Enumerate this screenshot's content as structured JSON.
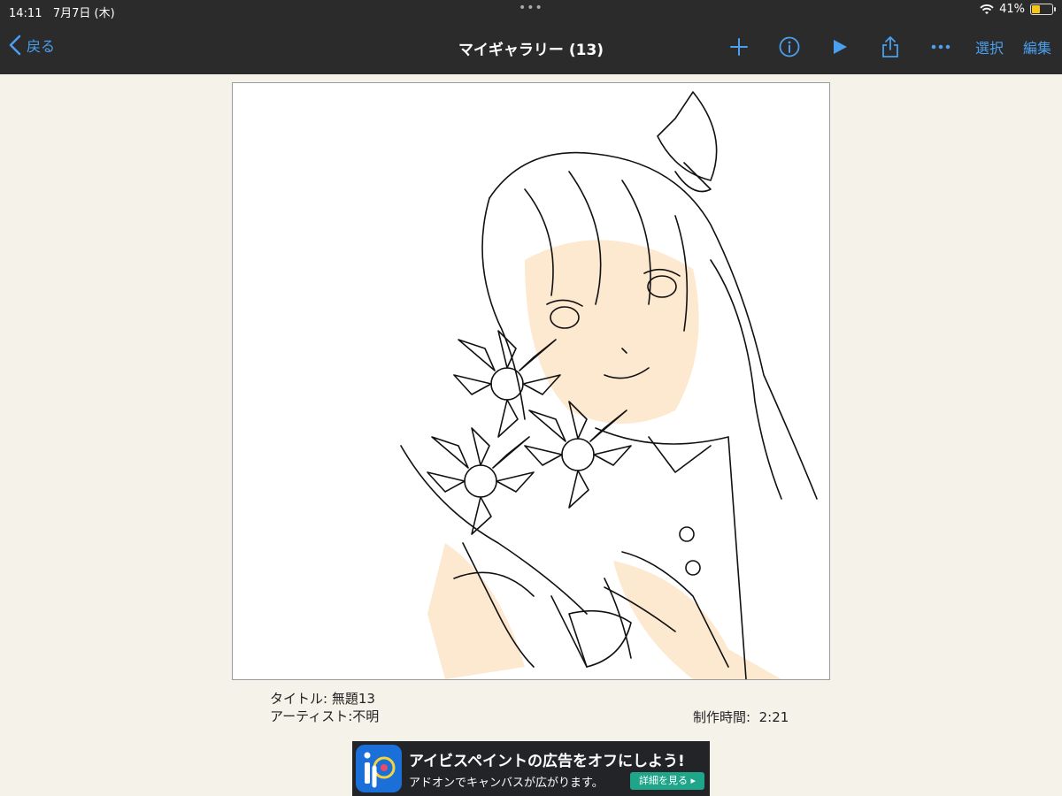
{
  "status_bar": {
    "time": "14:11",
    "date": "7月7日 (木)",
    "battery_percent_label": "41%",
    "battery_level": 0.41
  },
  "nav": {
    "back_label": "戻る",
    "title": "マイギャラリー (13)",
    "select_label": "選択",
    "edit_label": "編集",
    "accent_color": "#4a9fef"
  },
  "artwork": {
    "description_icon": "line-art-illustration"
  },
  "meta": {
    "title_line": "タイトル: 無題13",
    "artist_line": "アーティスト:不明",
    "time_label": "制作時間:",
    "time_value": "2:21"
  },
  "ad": {
    "headline": "アイビスペイントの広告をオフにしよう!",
    "subtext": "アドオンでキャンバスが広がります。",
    "cta": "詳細を見る ▸"
  }
}
